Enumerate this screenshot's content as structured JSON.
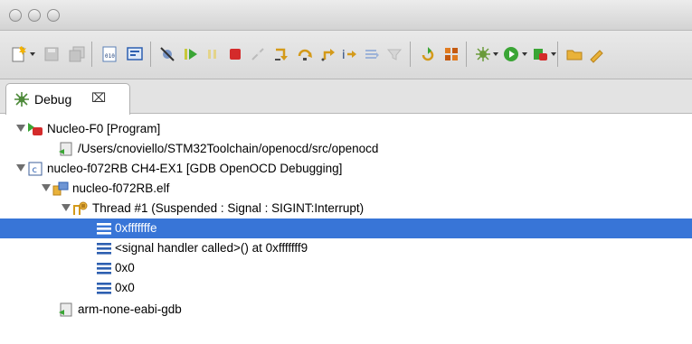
{
  "view": {
    "tab_label": "Debug",
    "tab_close": "⌧"
  },
  "tree": [
    {
      "label": "Nucleo-F0 [Program]",
      "icon": "program-launch-icon",
      "expanded": true
    },
    {
      "label": "/Users/cnoviello/STM32Toolchain/openocd/src/openocd",
      "icon": "process-icon"
    },
    {
      "label": "nucleo-f072RB CH4-EX1 [GDB OpenOCD Debugging]",
      "icon": "c-launch-config-icon",
      "expanded": true
    },
    {
      "label": "nucleo-f072RB.elf",
      "icon": "debug-target-icon",
      "expanded": true
    },
    {
      "label": "Thread #1 (Suspended : Signal : SIGINT:Interrupt)",
      "icon": "suspended-thread-icon",
      "expanded": true
    },
    {
      "label": "0xfffffffe",
      "icon": "stack-frame-icon",
      "selected": true
    },
    {
      "label": "<signal handler called>() at 0xfffffff9",
      "icon": "stack-frame-icon"
    },
    {
      "label": "0x0",
      "icon": "stack-frame-icon"
    },
    {
      "label": "0x0",
      "icon": "stack-frame-icon"
    },
    {
      "label": "arm-none-eabi-gdb",
      "icon": "process-icon"
    }
  ],
  "colors": {
    "selection": "#3875d7",
    "frame_icon": "#2d5fb0",
    "stop_red": "#d42b2b",
    "run_green": "#3aa535"
  }
}
